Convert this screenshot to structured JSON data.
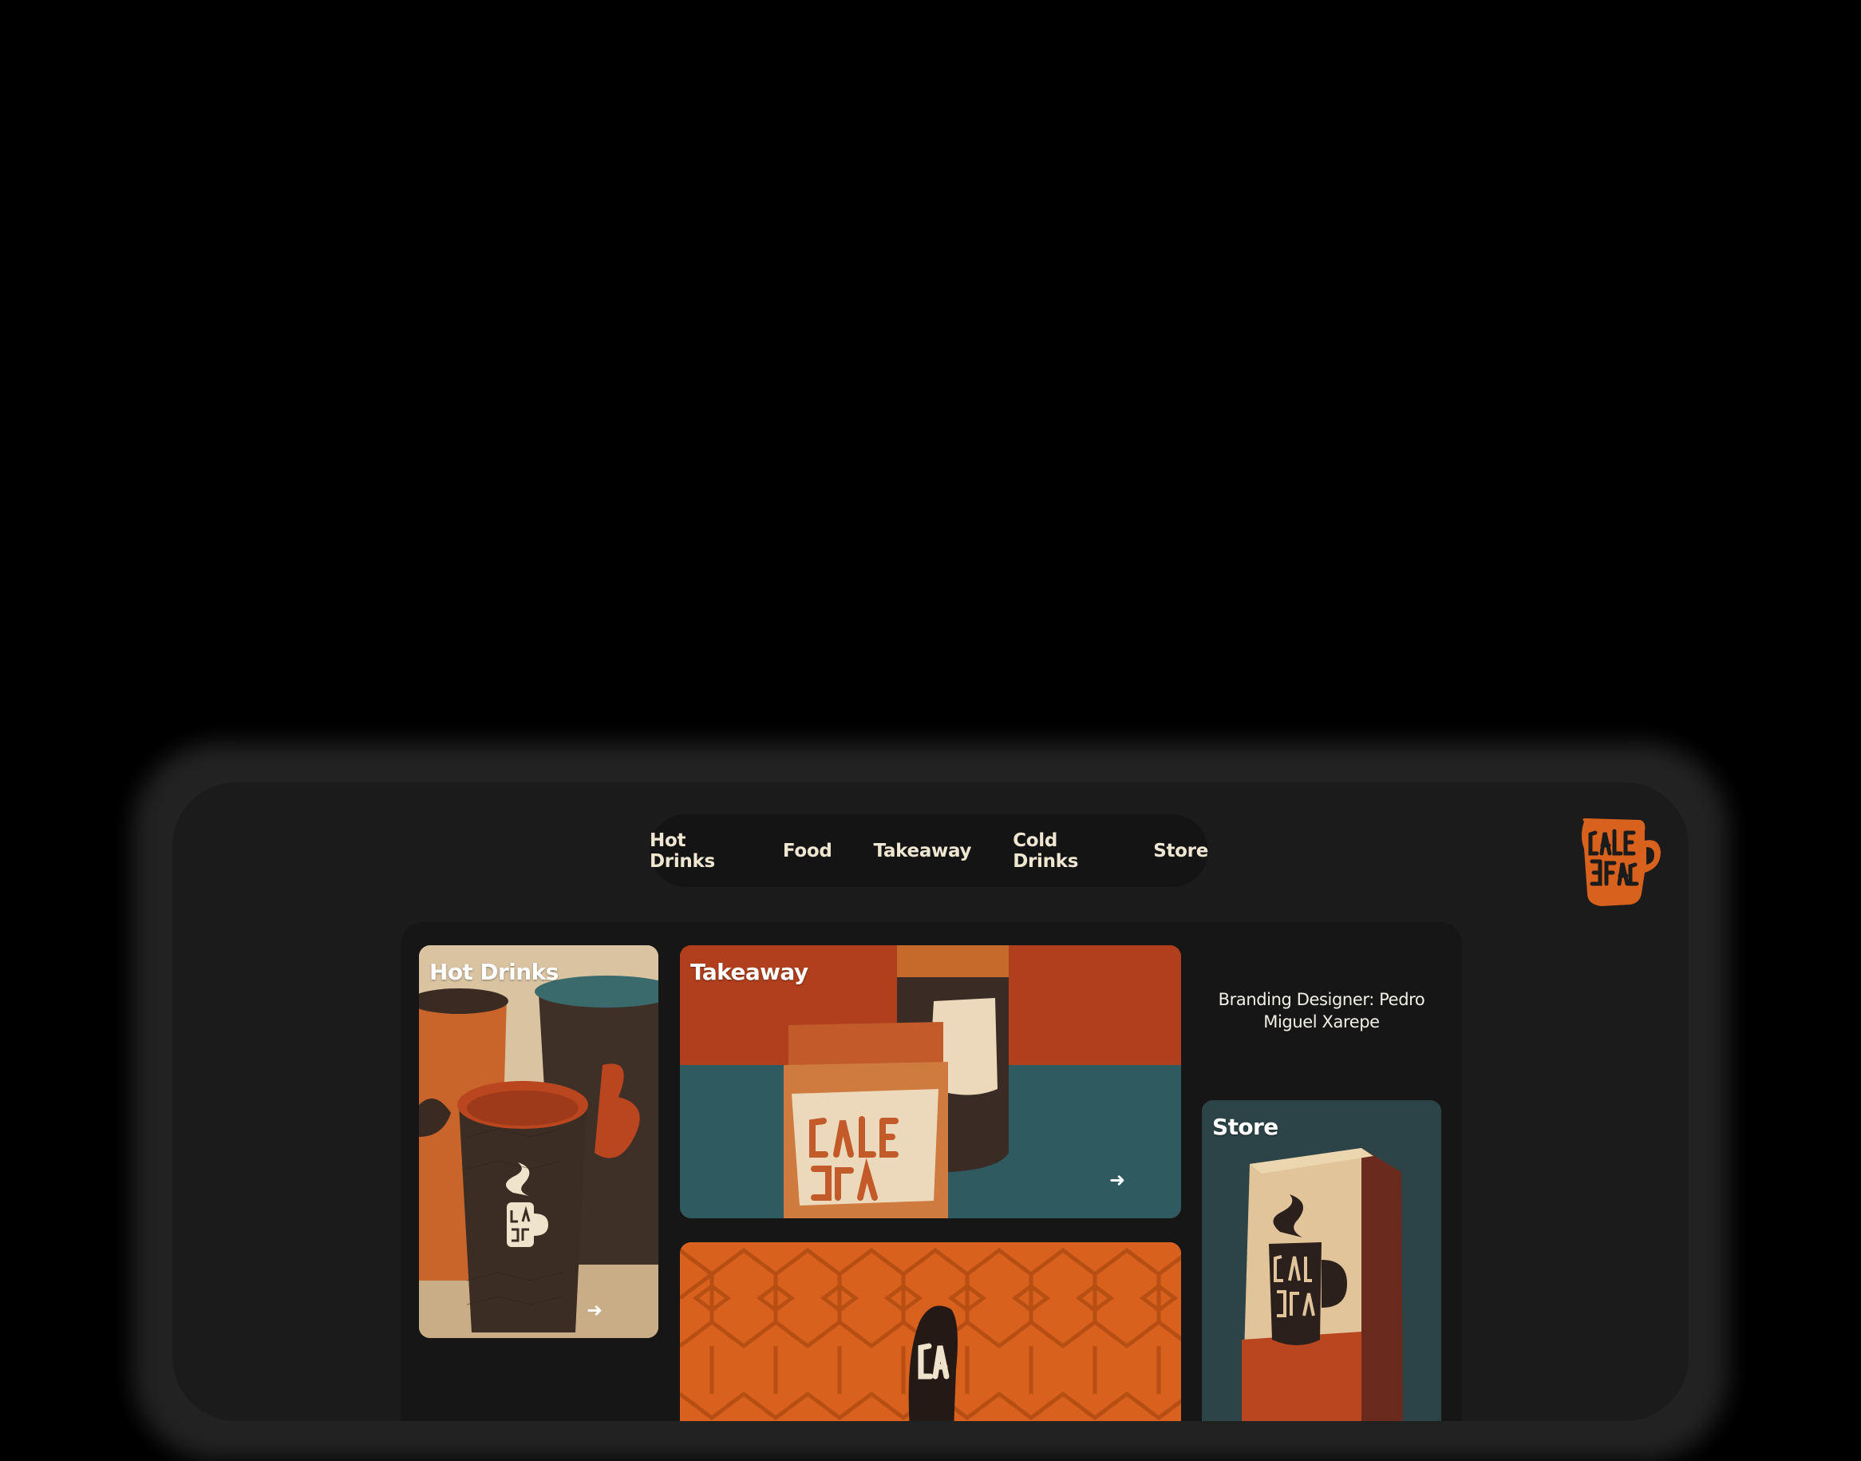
{
  "nav": {
    "items": [
      "Hot Drinks",
      "Food",
      "Takeaway",
      "Cold Drinks",
      "Store"
    ]
  },
  "logo": {
    "icon": "mug-logo-icon",
    "color": "#d8621d"
  },
  "cards": {
    "hot_drinks": {
      "title": "Hot Drinks",
      "arrow": "➜"
    },
    "takeaway": {
      "title": "Takeaway",
      "arrow": "➜"
    },
    "store": {
      "title": "Store"
    }
  },
  "credit": "Branding Designer: Pedro Miguel Xarepe",
  "colors": {
    "accent": "#d8621d",
    "rust": "#b9461f",
    "teal": "#2f5a5f",
    "dark_brown": "#3a2a22",
    "kraft": "#e1c49a"
  }
}
